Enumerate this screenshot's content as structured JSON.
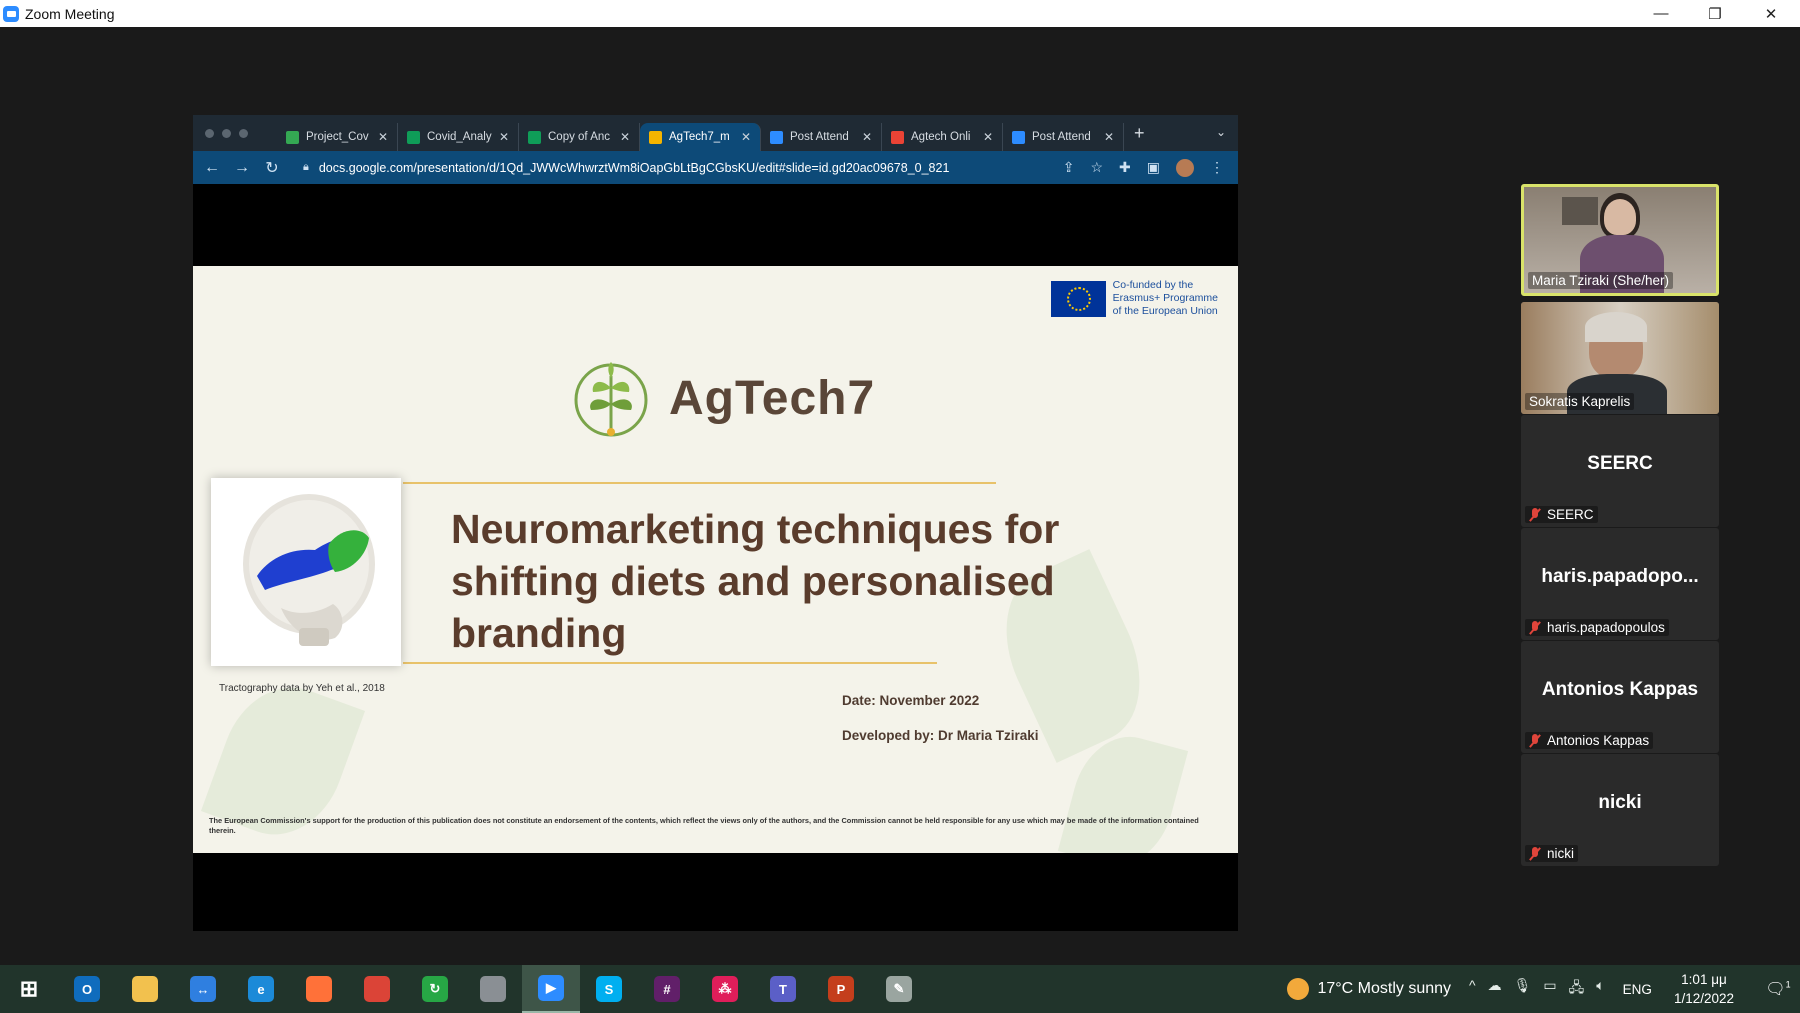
{
  "window": {
    "title": "Zoom Meeting",
    "minimize": "—",
    "restore": "❐",
    "close": "✕"
  },
  "browser": {
    "tabs": [
      {
        "label": "Project_Cov",
        "icon_color": "#34a853",
        "icon": "drive-icon"
      },
      {
        "label": "Covid_Analy",
        "icon_color": "#0f9d58",
        "icon": "sheets-icon"
      },
      {
        "label": "Copy of Anc",
        "icon_color": "#0f9d58",
        "icon": "sheets-icon"
      },
      {
        "label": "AgTech7_m",
        "icon_color": "#f4b400",
        "icon": "slides-icon"
      },
      {
        "label": "Post Attend",
        "icon_color": "#2d8cff",
        "icon": "zoom-icon"
      },
      {
        "label": "Agtech Onli",
        "icon_color": "#ea4335",
        "icon": "gmail-icon"
      },
      {
        "label": "Post Attend",
        "icon_color": "#2d8cff",
        "icon": "zoom-icon"
      }
    ],
    "active_tab_index": 3,
    "new_tab": "+",
    "tab_menu": "⌄",
    "url": "docs.google.com/presentation/d/1Qd_JWWcWhwrztWm8iOapGbLtBgCGbsKU/edit#slide=id.gd20ac09678_0_821"
  },
  "slide": {
    "eu_text_1": "Co-funded by the",
    "eu_text_2": "Erasmus+ Programme",
    "eu_text_3": "of the European Union",
    "logo_title": "AgTech7",
    "title": "Neuromarketing techniques for shifting diets and personalised branding",
    "caption": "Tractography data by Yeh et al., 2018",
    "date": "Date: November 2022",
    "developed_by": "Developed by: Dr Maria Tziraki",
    "disclaimer": "The European Commission's support for the production of this publication does not constitute an endorsement of the contents, which reflect the views only of the authors, and the Commission cannot be held responsible for any use which may be made of the information contained therein."
  },
  "participants": [
    {
      "name": "Maria Tziraki (She/her)",
      "video": true,
      "speaking": true,
      "muted": false
    },
    {
      "name": "Sokratis Kaprelis",
      "video": true,
      "speaking": false,
      "muted": false
    },
    {
      "name": "SEERC",
      "big": "SEERC",
      "video": false,
      "muted": true
    },
    {
      "name": "haris.papadopoulos",
      "big": "haris.papadopo...",
      "video": false,
      "muted": true
    },
    {
      "name": "Antonios Kappas",
      "big": "Antonios Kappas",
      "video": false,
      "muted": true
    },
    {
      "name": "nicki",
      "big": "nicki",
      "video": false,
      "muted": true
    }
  ],
  "taskbar": {
    "apps": [
      {
        "name": "start-button",
        "color": "#21342b",
        "glyph": "⊞"
      },
      {
        "name": "outlook-icon",
        "color": "#0f6cbd",
        "glyph": "O"
      },
      {
        "name": "file-explorer-icon",
        "color": "#f2c14e",
        "glyph": ""
      },
      {
        "name": "teamviewer-icon",
        "color": "#2f7fe0",
        "glyph": "↔"
      },
      {
        "name": "edge-icon",
        "color": "#1c8ad8",
        "glyph": "e"
      },
      {
        "name": "firefox-icon",
        "color": "#ff7139",
        "glyph": ""
      },
      {
        "name": "chrome-icon",
        "color": "#db4437",
        "glyph": ""
      },
      {
        "name": "green-app-icon",
        "color": "#27a745",
        "glyph": "↻"
      },
      {
        "name": "disk-app-icon",
        "color": "#8a8f94",
        "glyph": ""
      },
      {
        "name": "zoom-icon",
        "color": "#2d8cff",
        "glyph": "▶",
        "active": true
      },
      {
        "name": "skype-icon",
        "color": "#00aff0",
        "glyph": "S"
      },
      {
        "name": "slack-icon",
        "color": "#611f69",
        "glyph": "#"
      },
      {
        "name": "dots-app-icon",
        "color": "#e01e5a",
        "glyph": "⁂"
      },
      {
        "name": "teams-icon",
        "color": "#5b5fc7",
        "glyph": "T"
      },
      {
        "name": "powerpoint-icon",
        "color": "#c43e1c",
        "glyph": "P"
      },
      {
        "name": "paint-icon",
        "color": "#9aa5a0",
        "glyph": "✎"
      }
    ],
    "weather": "17°C  Mostly sunny",
    "language": "ENG",
    "time": "1:01 μμ",
    "date": "1/12/2022",
    "notifications": "1"
  }
}
